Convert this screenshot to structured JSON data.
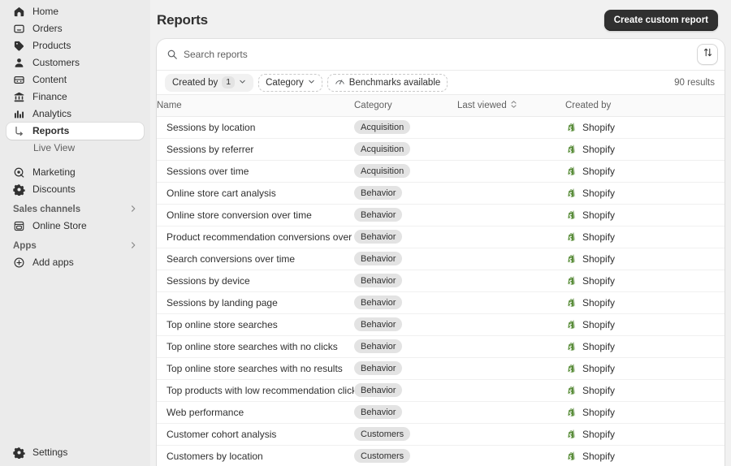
{
  "sidebar": {
    "items": [
      {
        "label": "Home",
        "icon": "home-icon"
      },
      {
        "label": "Orders",
        "icon": "orders-icon"
      },
      {
        "label": "Products",
        "icon": "products-tag-icon"
      },
      {
        "label": "Customers",
        "icon": "customers-person-icon"
      },
      {
        "label": "Content",
        "icon": "content-icon"
      },
      {
        "label": "Finance",
        "icon": "finance-bank-icon"
      },
      {
        "label": "Analytics",
        "icon": "analytics-bars-icon"
      }
    ],
    "sub_items": [
      {
        "label": "Reports",
        "active": true
      },
      {
        "label": "Live View",
        "active": false
      }
    ],
    "items2": [
      {
        "label": "Marketing",
        "icon": "marketing-icon"
      },
      {
        "label": "Discounts",
        "icon": "discounts-gear-icon"
      }
    ],
    "sales_channels": {
      "label": "Sales channels",
      "chevron": "chevron-right-icon",
      "items": [
        {
          "label": "Online Store",
          "icon": "online-store-icon"
        }
      ]
    },
    "apps": {
      "label": "Apps",
      "chevron": "chevron-right-icon",
      "items": [
        {
          "label": "Add apps",
          "icon": "plus-circle-icon"
        }
      ]
    },
    "settings": {
      "label": "Settings",
      "icon": "gear-icon"
    }
  },
  "header": {
    "title": "Reports",
    "primary_button": "Create custom report"
  },
  "search": {
    "placeholder": "Search reports",
    "value": "",
    "icon": "search-icon",
    "sort_button_icon": "sort-arrows-icon"
  },
  "filters": {
    "created_by": {
      "label": "Created by",
      "count": "1",
      "chevron": "chevron-down-icon"
    },
    "category": {
      "label": "Category",
      "chevron": "chevron-down-icon"
    },
    "benchmarks": {
      "label": "Benchmarks available",
      "icon": "benchmark-gauge-icon"
    },
    "results": "90 results"
  },
  "table": {
    "columns": [
      {
        "label": "Name",
        "key": "name"
      },
      {
        "label": "Category",
        "key": "category"
      },
      {
        "label": "Last viewed",
        "key": "last_viewed",
        "sort_icon": "sort-updown-icon"
      },
      {
        "label": "Created by",
        "key": "created_by"
      }
    ],
    "rows": [
      {
        "name": "Sessions by location",
        "category": "Acquisition",
        "last_viewed": "",
        "created_by": "Shopify"
      },
      {
        "name": "Sessions by referrer",
        "category": "Acquisition",
        "last_viewed": "",
        "created_by": "Shopify"
      },
      {
        "name": "Sessions over time",
        "category": "Acquisition",
        "last_viewed": "",
        "created_by": "Shopify"
      },
      {
        "name": "Online store cart analysis",
        "category": "Behavior",
        "last_viewed": "",
        "created_by": "Shopify"
      },
      {
        "name": "Online store conversion over time",
        "category": "Behavior",
        "last_viewed": "",
        "created_by": "Shopify"
      },
      {
        "name": "Product recommendation conversions over time",
        "category": "Behavior",
        "last_viewed": "",
        "created_by": "Shopify"
      },
      {
        "name": "Search conversions over time",
        "category": "Behavior",
        "last_viewed": "",
        "created_by": "Shopify"
      },
      {
        "name": "Sessions by device",
        "category": "Behavior",
        "last_viewed": "",
        "created_by": "Shopify"
      },
      {
        "name": "Sessions by landing page",
        "category": "Behavior",
        "last_viewed": "",
        "created_by": "Shopify"
      },
      {
        "name": "Top online store searches",
        "category": "Behavior",
        "last_viewed": "",
        "created_by": "Shopify"
      },
      {
        "name": "Top online store searches with no clicks",
        "category": "Behavior",
        "last_viewed": "",
        "created_by": "Shopify"
      },
      {
        "name": "Top online store searches with no results",
        "category": "Behavior",
        "last_viewed": "",
        "created_by": "Shopify"
      },
      {
        "name": "Top products with low recommendation click rate",
        "category": "Behavior",
        "last_viewed": "",
        "created_by": "Shopify"
      },
      {
        "name": "Web performance",
        "category": "Behavior",
        "last_viewed": "",
        "created_by": "Shopify"
      },
      {
        "name": "Customer cohort analysis",
        "category": "Customers",
        "last_viewed": "",
        "created_by": "Shopify"
      },
      {
        "name": "Customers by location",
        "category": "Customers",
        "last_viewed": "",
        "created_by": "Shopify"
      }
    ]
  },
  "colors": {
    "sidebar_bg": "#ebebeb",
    "page_bg": "#f1f1f1",
    "card_bg": "#ffffff",
    "text": "#303030",
    "muted_text": "#616161",
    "badge_bg": "#e3e3e3",
    "primary_button_bg": "#303030",
    "shopify_green": "#5a8e3a"
  }
}
